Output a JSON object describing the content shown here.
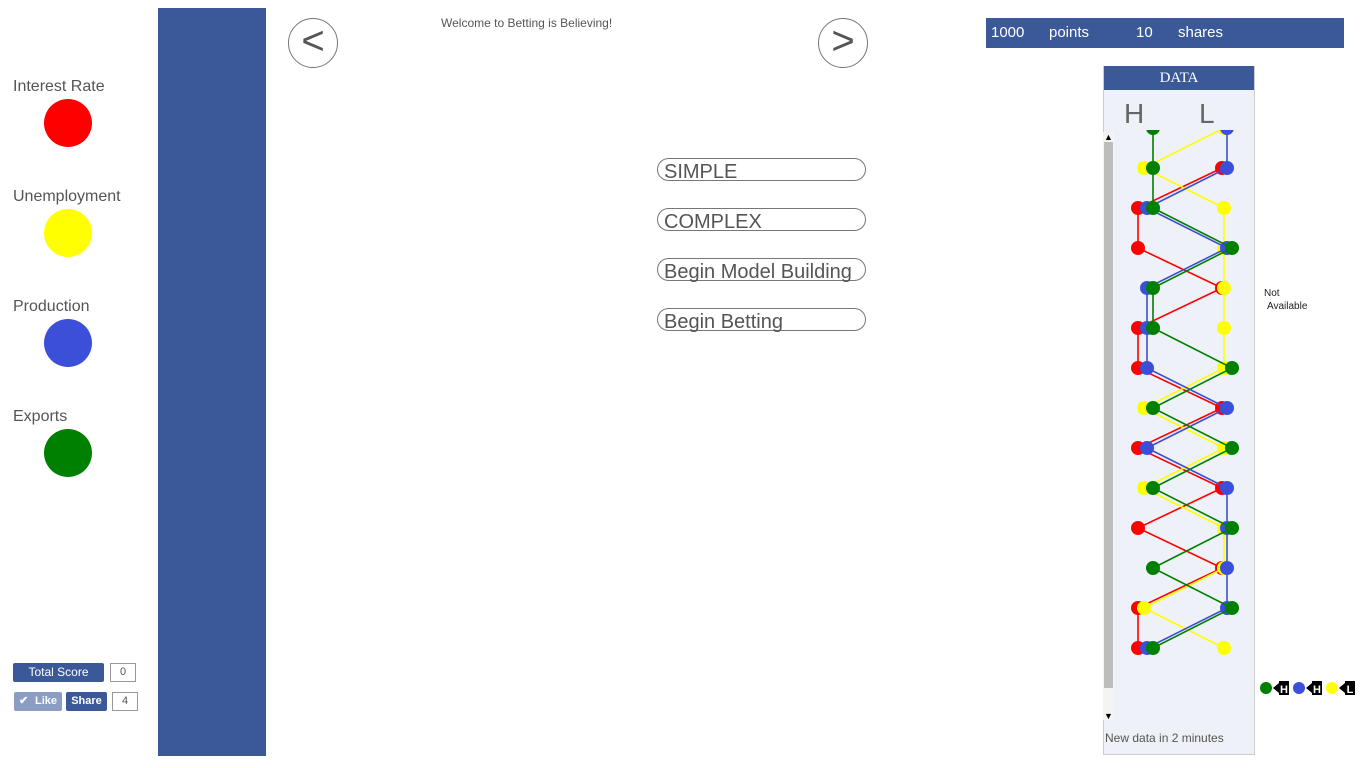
{
  "legend": {
    "items": [
      {
        "label": "Interest Rate",
        "color": "#ff0000"
      },
      {
        "label": "Unemployment",
        "color": "#ffff00"
      },
      {
        "label": "Production",
        "color": "#3b4fd8"
      },
      {
        "label": "Exports",
        "color": "#008000"
      }
    ]
  },
  "nav": {
    "prev_label": "<",
    "next_label": ">"
  },
  "welcome": "Welcome to Betting is Believing!",
  "modes": {
    "simple": "SIMPLE",
    "complex": "COMPLEX",
    "model_building": "Begin Model Building",
    "betting": "Begin Betting"
  },
  "topbar": {
    "points_value": "1000",
    "points_label": "points",
    "shares_value": "10",
    "shares_label": "shares"
  },
  "data_panel": {
    "title": "DATA",
    "high_label": "H",
    "low_label": "L",
    "not_available_1": "Not",
    "not_available_2": "Available",
    "new_data": "New data in 2 minutes",
    "scroll_up": "▲",
    "scroll_down": "▼"
  },
  "score": {
    "total_label": "Total Score",
    "total_value": "0",
    "like_label": "Like",
    "share_label": "Share",
    "share_count": "4"
  },
  "mini_indicators": [
    {
      "color": "#008000",
      "letter": "H"
    },
    {
      "color": "#3b4fd8",
      "letter": "H"
    },
    {
      "color": "#ffff00",
      "letter": "L"
    }
  ],
  "chart_data": {
    "type": "line",
    "title": "DATA",
    "xlabel": "",
    "ylabel": "",
    "x_categories": [
      "H",
      "L"
    ],
    "series": [
      {
        "color": "#ff0000",
        "values": [
          "L",
          "H",
          "H",
          "L",
          "H",
          "H",
          "L",
          "H",
          "L",
          "H",
          "L",
          "H",
          "H"
        ]
      },
      {
        "color": "#ffff00",
        "values": [
          "L",
          "H",
          "L",
          "L",
          "L",
          "L",
          "L",
          "H",
          "L",
          "H",
          "L",
          "L",
          "H",
          "L"
        ]
      },
      {
        "color": "#3b4fd8",
        "values": [
          "L",
          "L",
          "H",
          "L",
          "H",
          "H",
          "H",
          "L",
          "H",
          "L",
          "L",
          "L",
          "L",
          "H"
        ]
      },
      {
        "color": "#008000",
        "values": [
          "H",
          "H",
          "H",
          "L",
          "H",
          "H",
          "L",
          "H",
          "L",
          "H",
          "L",
          "H",
          "L",
          "H"
        ]
      }
    ]
  }
}
